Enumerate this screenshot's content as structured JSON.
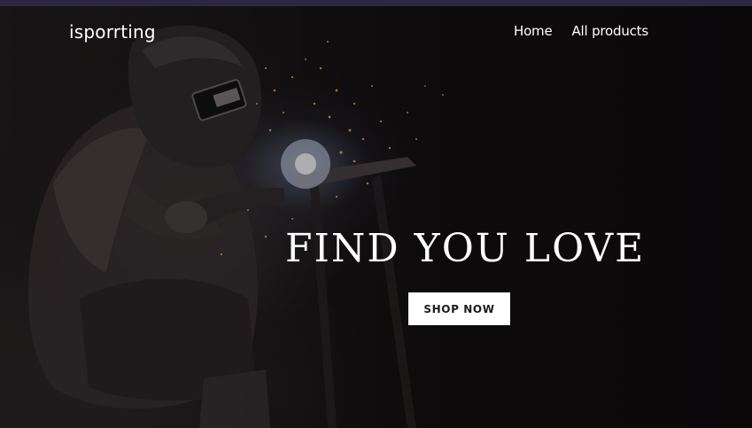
{
  "header": {
    "brand": "isporrting",
    "nav": [
      {
        "label": "Home"
      },
      {
        "label": "All products"
      }
    ]
  },
  "hero": {
    "headline": "FIND YOU LOVE",
    "cta_label": "SHOP NOW",
    "background_image": "welder-with-sparks"
  },
  "colors": {
    "topbar": "#2b2843",
    "text": "#ffffff",
    "button_bg": "#ffffff",
    "button_text": "#1b1b1b"
  }
}
